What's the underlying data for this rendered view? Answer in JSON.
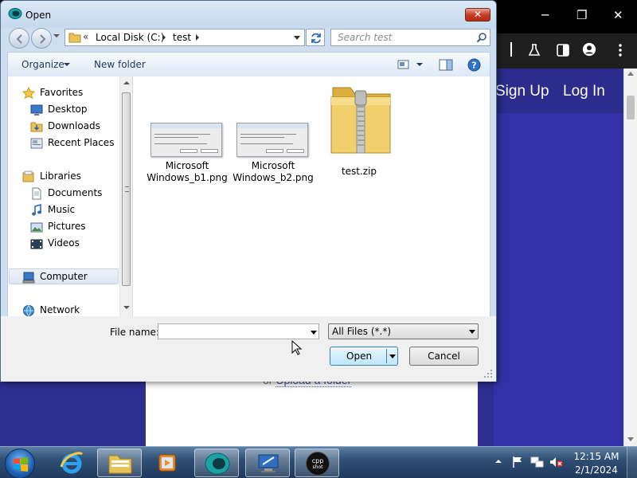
{
  "browser": {
    "signup_label": "Sign Up",
    "login_label": "Log In",
    "upload_prefix": "or",
    "upload_link": "Upload a folder",
    "minimize": "─",
    "restore": "❐",
    "close": "✕"
  },
  "dialog": {
    "title": "Open",
    "close_glyph": "✕",
    "address": {
      "chevron": "«",
      "segments": [
        "Local Disk (C:)",
        "test"
      ]
    },
    "search_placeholder": "Search test",
    "toolbar": {
      "organize": "Organize",
      "new_folder": "New folder"
    },
    "nav": {
      "favorites": "Favorites",
      "desktop": "Desktop",
      "downloads": "Downloads",
      "recent": "Recent Places",
      "libraries": "Libraries",
      "documents": "Documents",
      "music": "Music",
      "pictures": "Pictures",
      "videos": "Videos",
      "computer": "Computer",
      "network": "Network"
    },
    "files": [
      {
        "name_line1": "Microsoft",
        "name_line2": "Windows_b1.png",
        "icon": "png-thumbnail"
      },
      {
        "name_line1": "Microsoft",
        "name_line2": "Windows_b2.png",
        "icon": "png-thumbnail"
      },
      {
        "name_line1": "test.zip",
        "name_line2": "",
        "icon": "zip-folder-icon"
      }
    ],
    "file_name_label": "File name:",
    "file_name_value": "",
    "filter": "All Files (*.*)",
    "open_label": "Open",
    "cancel_label": "Cancel"
  },
  "taskbar": {
    "time": "12:15 AM",
    "date": "2/1/2024",
    "pinned": [
      "internet-explorer-icon",
      "file-explorer-icon",
      "media-player-icon",
      "app-bubble-icon",
      "remote-desktop-icon",
      "cpp-shot-icon"
    ],
    "cpp_label_1": "cpp",
    "cpp_label_2": "shot"
  },
  "colors": {
    "site_background": "#3431a8",
    "dialog_frame": "#cfdff0",
    "taskbar": "#2f4f74",
    "open_button": "#bee6fd"
  }
}
